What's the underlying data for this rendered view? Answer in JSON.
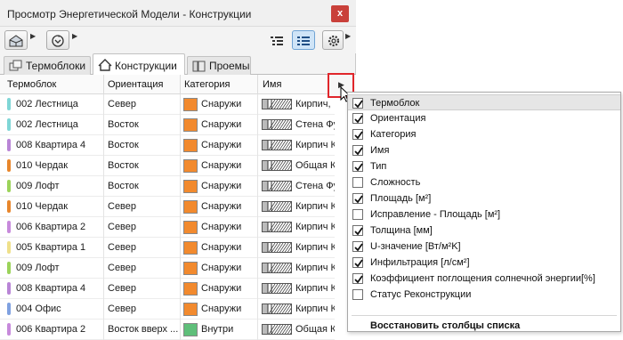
{
  "window": {
    "title": "Просмотр Энергетической Модели - Конструкции",
    "close_glyph": "x"
  },
  "toolbar": {
    "left_buttons": [
      "model-view-icon",
      "refresh-icon"
    ],
    "right_buttons": [
      "list-view-icon",
      "details-view-icon",
      "settings-icon"
    ]
  },
  "tabs": [
    {
      "label": "Термоблоки",
      "icon": "thermal-block-icon",
      "active": false
    },
    {
      "label": "Конструкции",
      "icon": "house-icon",
      "active": true
    },
    {
      "label": "Проемы",
      "icon": "openings-icon",
      "active": false
    }
  ],
  "columns": [
    "Термоблок",
    "Ориентация",
    "Категория",
    "Имя"
  ],
  "rows": [
    {
      "block": "002 Лестница",
      "tag_color": "#7fd6d6",
      "orientation": "Север",
      "category": "Снаружи",
      "cat_color": "#f28a2e",
      "name": "Кирпич,"
    },
    {
      "block": "002 Лестница",
      "tag_color": "#7fd6d6",
      "orientation": "Восток",
      "category": "Снаружи",
      "cat_color": "#f28a2e",
      "name": "Стена Фу"
    },
    {
      "block": "008 Квартира 4",
      "tag_color": "#b985d6",
      "orientation": "Восток",
      "category": "Снаружи",
      "cat_color": "#f28a2e",
      "name": "Кирпич К"
    },
    {
      "block": "010 Чердак",
      "tag_color": "#e8862b",
      "orientation": "Восток",
      "category": "Снаружи",
      "cat_color": "#f28a2e",
      "name": "Общая К"
    },
    {
      "block": "009 Лофт",
      "tag_color": "#9bd35a",
      "orientation": "Восток",
      "category": "Снаружи",
      "cat_color": "#f28a2e",
      "name": "Стена Фу"
    },
    {
      "block": "010 Чердак",
      "tag_color": "#e8862b",
      "orientation": "Север",
      "category": "Снаружи",
      "cat_color": "#f28a2e",
      "name": "Кирпич К"
    },
    {
      "block": "006 Квартира 2",
      "tag_color": "#c78adb",
      "orientation": "Север",
      "category": "Снаружи",
      "cat_color": "#f28a2e",
      "name": "Кирпич К"
    },
    {
      "block": "005 Квартира 1",
      "tag_color": "#efe08a",
      "orientation": "Север",
      "category": "Снаружи",
      "cat_color": "#f28a2e",
      "name": "Кирпич К"
    },
    {
      "block": "009 Лофт",
      "tag_color": "#9bd35a",
      "orientation": "Север",
      "category": "Снаружи",
      "cat_color": "#f28a2e",
      "name": "Кирпич К"
    },
    {
      "block": "008 Квартира 4",
      "tag_color": "#b985d6",
      "orientation": "Север",
      "category": "Снаружи",
      "cat_color": "#f28a2e",
      "name": "Кирпич К"
    },
    {
      "block": "004 Офис",
      "tag_color": "#7fa1e0",
      "orientation": "Север",
      "category": "Снаружи",
      "cat_color": "#f28a2e",
      "name": "Кирпич К"
    },
    {
      "block": "006 Квартира 2",
      "tag_color": "#c78adb",
      "orientation": "Восток вверх ...",
      "category": "Внутри",
      "cat_color": "#5fbf7a",
      "name": "Общая К"
    }
  ],
  "column_menu": {
    "items": [
      {
        "label": "Термоблок",
        "checked": true,
        "highlight": true
      },
      {
        "label": "Ориентация",
        "checked": true
      },
      {
        "label": "Категория",
        "checked": true
      },
      {
        "label": "Имя",
        "checked": true
      },
      {
        "label": "Тип",
        "checked": true
      },
      {
        "label": "Сложность",
        "checked": false
      },
      {
        "label": "Площадь [м²]",
        "checked": true
      },
      {
        "label": "Исправление  - Площадь [м²]",
        "checked": false
      },
      {
        "label": "Толщина [мм]",
        "checked": true
      },
      {
        "label": "U-значение [Вт/м²K]",
        "checked": true
      },
      {
        "label": "Инфильтрация [л/см²]",
        "checked": true
      },
      {
        "label": "Коэффициент поглощения солнечной энергии[%]",
        "checked": true
      },
      {
        "label": "Статус Реконструкции",
        "checked": false
      }
    ],
    "restore_label": "Восстановить столбцы списка"
  }
}
